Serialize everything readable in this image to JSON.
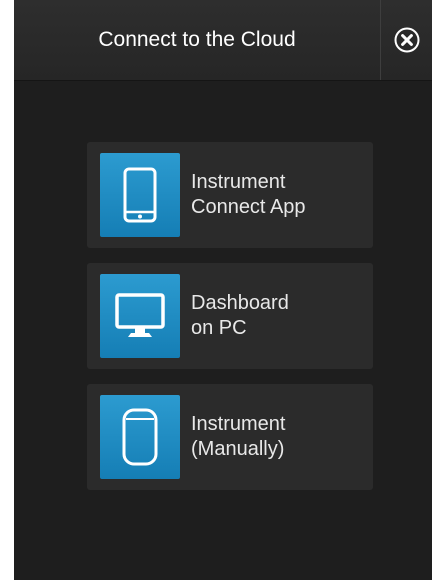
{
  "dialog": {
    "title": "Connect to the Cloud"
  },
  "options": [
    {
      "line1": "Instrument",
      "line2": "Connect App",
      "icon": "smartphone-icon"
    },
    {
      "line1": "Dashboard",
      "line2": "on PC",
      "icon": "monitor-icon"
    },
    {
      "line1": "Instrument",
      "line2": "(Manually)",
      "icon": "instrument-device-icon"
    }
  ],
  "colors": {
    "background": "#1e1e1e",
    "header": "#2a2a2a",
    "tile": "#2b2b2b",
    "accent": "#1a8bc4",
    "text": "#e8e8e8"
  }
}
